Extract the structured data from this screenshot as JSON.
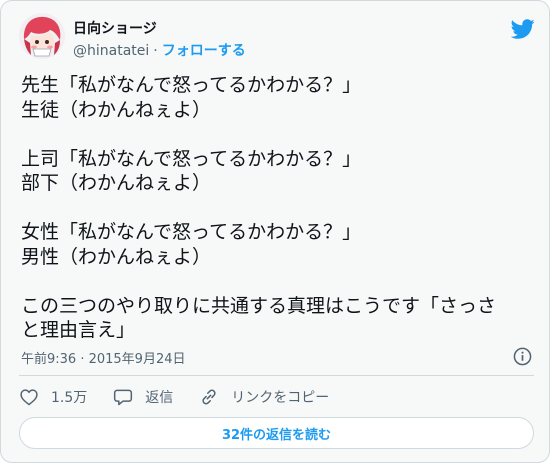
{
  "author": {
    "display_name": "日向ショージ",
    "handle": "@hinatatei",
    "separator": "·",
    "follow_label": "フォローする"
  },
  "tweet": {
    "lines": [
      "先生「私がなんで怒ってるかわかる？」",
      "生徒（わかんねぇよ）",
      "",
      "上司「私がなんで怒ってるかわかる？」",
      "部下（わかんねぇよ）",
      "",
      "女性「私がなんで怒ってるかわかる？」",
      "男性（わかんねぇよ）",
      "",
      "この三つのやり取りに共通する真理はこうです「さっさ",
      "と理由言え」"
    ]
  },
  "meta": {
    "timestamp": "午前9:36 · 2015年9月24日"
  },
  "actions": {
    "like_count": "1.5万",
    "reply_label": "返信",
    "copy_link_label": "リンクをコピー"
  },
  "read_replies_label": "32件の返信を読む",
  "colors": {
    "accent": "#1d9bf0",
    "text": "#0f1419",
    "muted": "#536471",
    "border": "#cfd9de",
    "background": "#f7f9f9"
  },
  "icons": {
    "brand": "twitter-bird-icon",
    "info": "info-icon",
    "like": "heart-icon",
    "reply": "speech-bubble-icon",
    "link": "link-icon"
  }
}
